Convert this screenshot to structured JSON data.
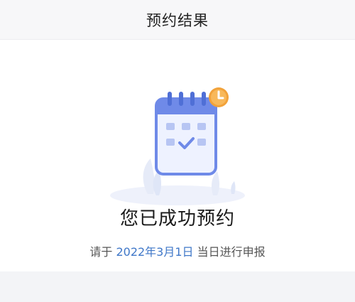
{
  "header": {
    "title": "预约结果"
  },
  "result": {
    "title": "您已成功预约",
    "notice_prefix": "请于 ",
    "notice_date": "2022年3月1日",
    "notice_suffix": " 当日进行申报"
  },
  "colors": {
    "accent_blue": "#3f77c8",
    "calendar_blue": "#5b79e0",
    "clock_orange": "#f2a23a"
  },
  "icons": {
    "illustration": "calendar-check-icon",
    "badge": "clock-icon"
  }
}
